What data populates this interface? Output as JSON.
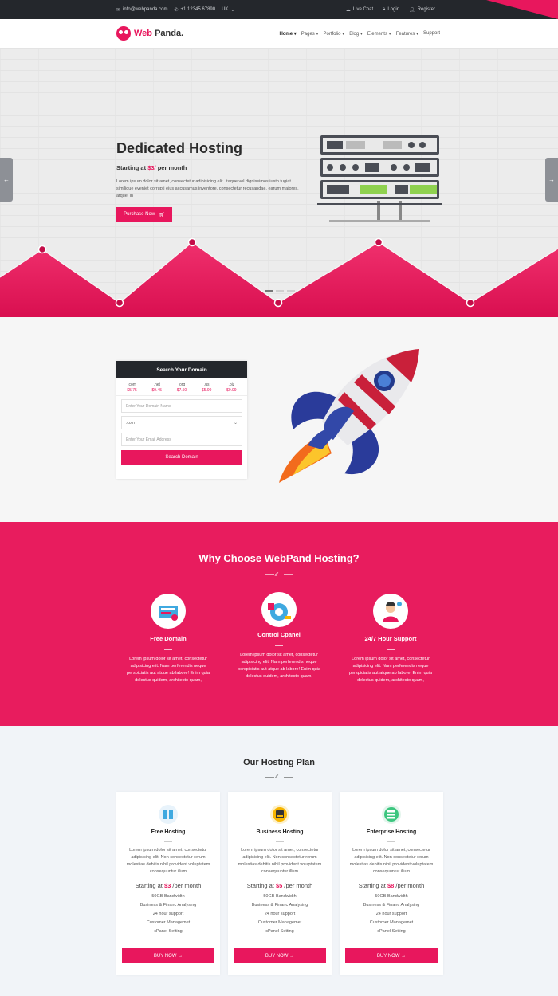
{
  "topbar": {
    "email": "info@webpanda.com",
    "phone": "+1 12345 67890",
    "language": "UK",
    "live_chat": "Live Chat",
    "login": "Login",
    "register": "Register"
  },
  "header": {
    "logo_web": "Web",
    "logo_panda": "Panda.",
    "nav": [
      "Home",
      "Pages",
      "Portfolio",
      "Blog",
      "Elements",
      "Features",
      "Support"
    ]
  },
  "hero": {
    "title": "Dedicated Hosting",
    "price_prefix": "Starting at",
    "price_value": "$3/",
    "price_suffix": "per month",
    "text": "Lorem ipsum dolor sit amet, consectetur adipisicing elit. Itaque vel dignissimos iusto fugiat similique eveniet corrupti eius accusamus inventore, consectetur recusandae, earum maiores, atque, in",
    "button": "Purchase Now",
    "prev_arrow": "←",
    "next_arrow": "→"
  },
  "domain": {
    "heading": "Search Your Domain",
    "tlds": [
      {
        "ext": ".com",
        "price": "$5.75"
      },
      {
        "ext": ".net",
        "price": "$9.45"
      },
      {
        "ext": ".org",
        "price": "$7.50"
      },
      {
        "ext": ".us",
        "price": "$5.99"
      },
      {
        "ext": ".biz",
        "price": "$9.99"
      }
    ],
    "name_placeholder": "Enter Your Domain Name",
    "select_value": ".com",
    "email_placeholder": "Enter Your Email Address",
    "button": "Search Domain"
  },
  "why": {
    "title": "Why Choose WebPand Hosting?",
    "features": [
      {
        "title": "Free Domain",
        "text": "Lorem ipsum dolor sit amet, consectetur adipisicing elit. Nam perferendis neque perspiciatis aut atque ab labore! Enim quia delectus quidem, architecto quam,"
      },
      {
        "title": "Control Cpanel",
        "text": "Lorem ipsum dolor sit amet, consectetur adipisicing elit. Nam perferendis neque perspiciatis aut atque ab labore! Enim quia delectus quidem, architecto quam,"
      },
      {
        "title": "24/7 Hour Support",
        "text": "Lorem ipsum dolor sit amet, consectetur adipisicing elit. Nam perferendis neque perspiciatis aut atque ab labore! Enim quia delectus quidem, architecto quam,"
      }
    ]
  },
  "plans": {
    "title": "Our Hosting Plan",
    "items": [
      {
        "name": "Free Hosting",
        "text": "Lorem ipsum dolor sit amet, consectetur adipisicing elit. Non consectetur rerum molestias debitis nihil provident voluptatem consequuntur illum",
        "price_prefix": "Starting at",
        "price": "$3",
        "price_suffix": "/per month",
        "features": [
          "50GB Bandwidth",
          "Business & Financ Analysing",
          "24 hour support",
          "Customer Managemet",
          "cPanel Setting"
        ],
        "button": "BUY NOW →",
        "icon_color": "#e8f3fb"
      },
      {
        "name": "Business Hosting",
        "text": "Lorem ipsum dolor sit amet, consectetur adipisicing elit. Non consectetur rerum molestias debitis nihil provident voluptatem consequuntur illum",
        "price_prefix": "Starting at",
        "price": "$5",
        "price_suffix": "/per month",
        "features": [
          "50GB Bandwidth",
          "Business & Financ Analysing",
          "24 hour support",
          "Customer Managemet",
          "cPanel Setting"
        ],
        "button": "BUY NOW →",
        "icon_color": "#fdf0c8"
      },
      {
        "name": "Enterprise Hosting",
        "text": "Lorem ipsum dolor sit amet, consectetur adipisicing elit. Non consectetur rerum molestias debitis nihil provident voluptatem consequuntur illum",
        "price_prefix": "Starting at",
        "price": "$8",
        "price_suffix": "/per month",
        "features": [
          "50GB Bandwidth",
          "Business & Financ Analysing",
          "24 hour support",
          "Customer Managemet",
          "cPanel Setting"
        ],
        "button": "BUY NOW →",
        "icon_color": "#e3f5ec"
      }
    ]
  },
  "colors": {
    "accent": "#e8175d",
    "dark": "#24272c"
  }
}
